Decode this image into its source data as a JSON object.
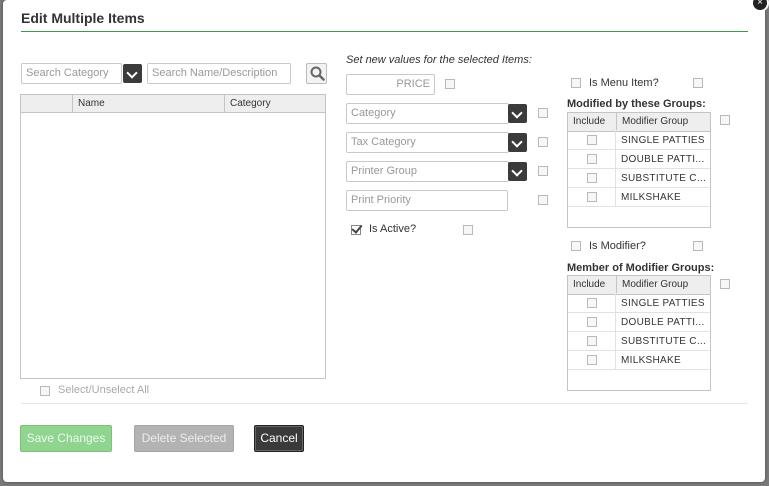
{
  "dialog": {
    "title": "Edit Multiple Items",
    "close_glyph": "×"
  },
  "left_panel": {
    "search_category_placeholder": "Search Category",
    "search_name_placeholder": "Search Name/Description",
    "columns": [
      "Name",
      "Category"
    ],
    "rows": [],
    "select_all_label": "Select/Unselect All"
  },
  "middle_panel": {
    "instructions": "Set new values for the selected Items:",
    "price_placeholder": "PRICE",
    "category_placeholder": "Category",
    "tax_category_placeholder": "Tax Category",
    "printer_group_placeholder": "Printer Group",
    "print_priority_placeholder": "Print Priority",
    "is_active_label": "Is Active?",
    "is_active_checked": true
  },
  "right_panel": {
    "is_menu_item_label": "Is Menu Item?",
    "modified_by_heading": "Modified by these Groups:",
    "include_header": "Include",
    "modifier_group_header": "Modifier Group",
    "modified_by_groups": [
      "SINGLE PATTIES",
      "DOUBLE PATTI...",
      "SUBSTITUTE C...",
      "MILKSHAKE"
    ],
    "is_modifier_label": "Is Modifier?",
    "member_of_heading": "Member of Modifier Groups:",
    "member_of_groups": [
      "SINGLE PATTIES",
      "DOUBLE PATTI...",
      "SUBSTITUTE C...",
      "MILKSHAKE"
    ]
  },
  "footer": {
    "save_label": "Save Changes",
    "delete_label": "Delete Selected",
    "cancel_label": "Cancel"
  },
  "colors": {
    "accent_green": "#3c9a46",
    "save_button": "#8fd48f",
    "delete_button": "#b3b3b3",
    "cancel_button": "#3a3a3a"
  },
  "icons": {
    "search": "search-icon",
    "dropdown": "chevron-down-icon",
    "close": "close-icon"
  }
}
